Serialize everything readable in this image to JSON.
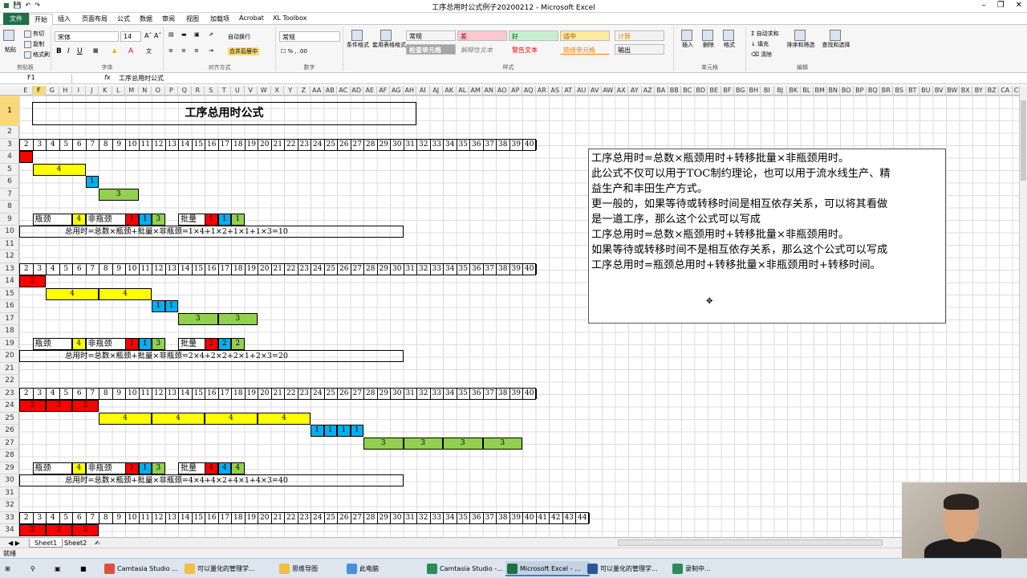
{
  "window": {
    "title": "工序总用时公式例子20200212 - Microsoft Excel"
  },
  "tabs": [
    "文件",
    "开始",
    "插入",
    "页面布局",
    "公式",
    "数据",
    "审阅",
    "视图",
    "加载项",
    "Acrobat",
    "XL Toolbox"
  ],
  "ribbon": {
    "clipboard": {
      "label": "剪贴板",
      "paste": "粘贴",
      "cut": "剪切",
      "copy": "复制",
      "painter": "格式刷"
    },
    "font": {
      "label": "字体",
      "name": "宋体",
      "size": "14"
    },
    "align": {
      "label": "对齐方式",
      "wrap": "自动换行",
      "merge": "合并后居中"
    },
    "number": {
      "label": "数字",
      "format": "常规"
    },
    "styles": {
      "label": "样式",
      "cond": "条件格式",
      "table": "套用表格格式",
      "items": [
        {
          "text": "常规",
          "color": "#ffffff"
        },
        {
          "text": "差",
          "color": "#ffc7ce"
        },
        {
          "text": "好",
          "color": "#c6efce"
        },
        {
          "text": "适中",
          "color": "#ffeb9c"
        },
        {
          "text": "计算",
          "color": "#f2f2f2"
        },
        {
          "text": "检查单元格",
          "color": "#a5a5a5"
        },
        {
          "text": "解释性文本",
          "color": "#ffffff"
        },
        {
          "text": "警告文本",
          "color": "#ffffff"
        },
        {
          "text": "链接单元格",
          "color": "#ffffff"
        },
        {
          "text": "输出",
          "color": "#f2f2f2"
        }
      ]
    },
    "cells": {
      "label": "单元格",
      "insert": "插入",
      "delete": "删除",
      "format": "格式"
    },
    "edit": {
      "label": "编辑",
      "autosum": "自动求和",
      "fill": "填充",
      "clear": "清除",
      "sort": "排序和筛选",
      "find": "查找和选择"
    }
  },
  "formula_bar": {
    "name_box": "F1",
    "fx": "fx",
    "value": "工序总用时公式"
  },
  "columns": [
    "E",
    "F",
    "G",
    "H",
    "I",
    "J",
    "K",
    "L",
    "M",
    "N",
    "O",
    "P",
    "Q",
    "R",
    "S",
    "T",
    "U",
    "V",
    "W",
    "X",
    "Y",
    "Z",
    "AA",
    "AB",
    "AC",
    "AD",
    "AE",
    "AF",
    "AG",
    "AH",
    "AI",
    "AJ",
    "AK",
    "AL",
    "AM",
    "AN",
    "AO",
    "AP",
    "AQ",
    "AR",
    "AS",
    "AT",
    "AU",
    "AV",
    "AW",
    "AX",
    "AY",
    "AZ",
    "BA",
    "BB",
    "BC",
    "BD",
    "BE",
    "BF",
    "BG",
    "BH",
    "BI",
    "BJ",
    "BK",
    "BL",
    "BM",
    "BN",
    "BO",
    "BP",
    "BQ",
    "BR",
    "BS",
    "BT",
    "BU",
    "BV",
    "BW",
    "BX",
    "BY",
    "BZ",
    "CA",
    "CB"
  ],
  "rows": [
    "1",
    "2",
    "3",
    "4",
    "5",
    "6",
    "7",
    "8",
    "9",
    "10",
    "11",
    "12",
    "13",
    "14",
    "15",
    "16",
    "17",
    "18",
    "19",
    "20",
    "21",
    "22",
    "23",
    "24",
    "25",
    "26",
    "27",
    "28",
    "29",
    "30",
    "31",
    "32",
    "33",
    "34"
  ],
  "sheet": {
    "title": "工序总用时公式",
    "nums40": [
      "2",
      "3",
      "4",
      "5",
      "6",
      "7",
      "8",
      "9",
      "10",
      "11",
      "12",
      "13",
      "14",
      "15",
      "16",
      "17",
      "18",
      "19",
      "20",
      "21",
      "22",
      "23",
      "24",
      "25",
      "26",
      "27",
      "28",
      "29",
      "30",
      "31",
      "32",
      "33",
      "34",
      "35",
      "36",
      "37",
      "38",
      "39",
      "40"
    ],
    "nums44": [
      "2",
      "3",
      "4",
      "5",
      "6",
      "7",
      "8",
      "9",
      "10",
      "11",
      "12",
      "13",
      "14",
      "15",
      "16",
      "17",
      "18",
      "19",
      "20",
      "21",
      "22",
      "23",
      "24",
      "25",
      "26",
      "27",
      "28",
      "29",
      "30",
      "31",
      "32",
      "33",
      "34",
      "35",
      "36",
      "37",
      "38",
      "39",
      "40",
      "41",
      "42",
      "43",
      "44"
    ],
    "labels": {
      "bottleneck": "瓶颈",
      "nonbottleneck": "非瓶颈",
      "batch": "批量"
    },
    "blocks": [
      {
        "red": [],
        "yellow": [
          "4"
        ],
        "blue": [
          "1"
        ],
        "green": [
          "3"
        ],
        "bneck": "4",
        "nb": [
          "1",
          "1",
          "3"
        ],
        "batch": [
          "1",
          "1",
          "1"
        ],
        "formula": "总用时=总数×瓶颈+批量×非瓶颈=1×4+1×2+1×1+1×3=10"
      },
      {
        "red": [
          "2"
        ],
        "yellow": [
          "4",
          "4"
        ],
        "blue": [
          "1",
          "1"
        ],
        "green": [
          "3",
          "3"
        ],
        "bneck": "4",
        "nb": [
          "1",
          "1",
          "3"
        ],
        "batch": [
          "2",
          "2",
          "2"
        ],
        "formula": "总用时=总数×瓶颈+批量×非瓶颈=2×4+2×2+2×1+2×3=20"
      },
      {
        "red": [
          "2",
          "2",
          "2"
        ],
        "yellow": [
          "4",
          "4",
          "4",
          "4"
        ],
        "blue": [
          "1",
          "1",
          "1",
          "1"
        ],
        "green": [
          "3",
          "3",
          "3",
          "3"
        ],
        "bneck": "4",
        "nb": [
          "1",
          "1",
          "3"
        ],
        "batch": [
          "4",
          "4",
          "4"
        ],
        "formula": "总用时=总数×瓶颈+批量×非瓶颈=4×4+4×2+4×1+4×3=40"
      },
      {
        "red": [
          "2",
          "2",
          "2"
        ]
      }
    ],
    "notes": [
      "工序总用时=总数×瓶颈用时+转移批量×非瓶颈用时。",
      "此公式不仅可以用于TOC制约理论，也可以用于流水线生产、精",
      "益生产和丰田生产方式。",
      "更一般的，如果等待或转移时间是相互依存关系，可以将其看做",
      "是一道工序，那么这个公式可以写成",
      "工序总用时=总数×瓶颈用时+转移批量×非瓶颈用时。",
      "如果等待或转移时间不是相互依存关系，那么这个公式可以写成",
      "工序总用时=瓶颈总用时+转移批量×非瓶颈用时+转移时间。"
    ]
  },
  "sheet_tabs": [
    "Sheet1",
    "Sheet2"
  ],
  "status": "就绪",
  "taskbar": [
    {
      "label": "Camtasia Studio ...",
      "color": "#e84b3c"
    },
    {
      "label": "可以量化的管理学...",
      "color": "#f0c040"
    },
    {
      "label": "思维导图",
      "color": "#f0c040"
    },
    {
      "label": "此电脑",
      "color": "#4a90d9"
    },
    {
      "label": "Camtasia Studio -...",
      "color": "#2e8b57"
    },
    {
      "label": "Microsoft Excel - ...",
      "color": "#1e7145"
    },
    {
      "label": "可以量化的管理学...",
      "color": "#2b579a"
    },
    {
      "label": "录制中...",
      "color": "#2e8b57"
    }
  ]
}
